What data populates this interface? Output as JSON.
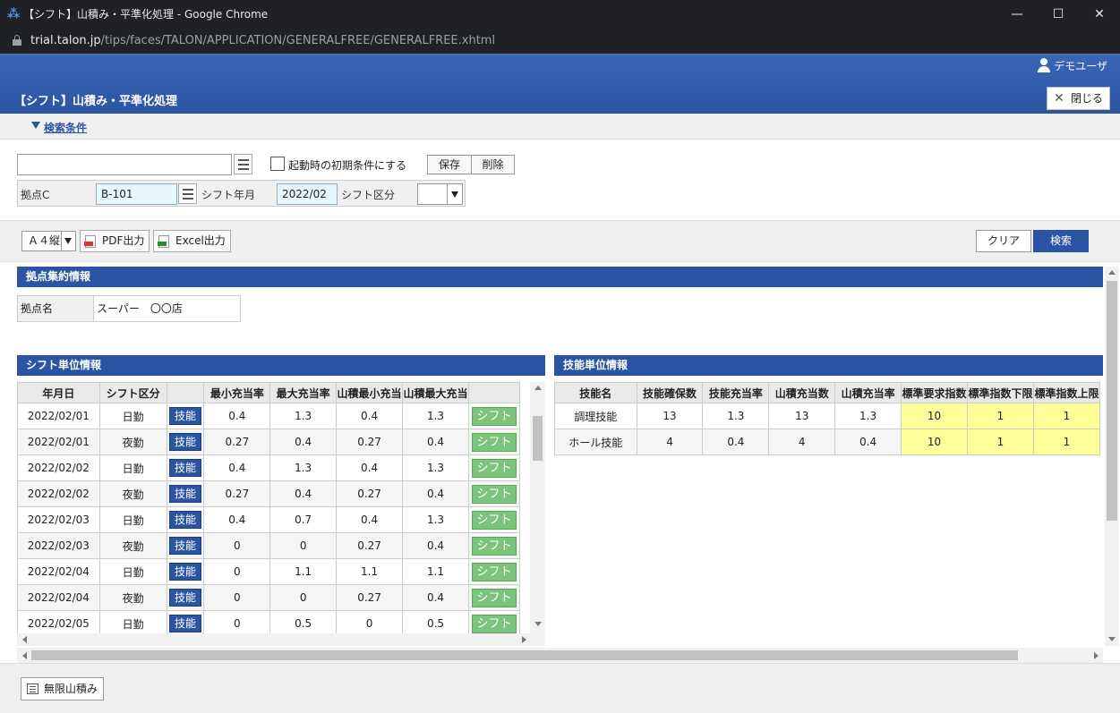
{
  "window": {
    "title": "【シフト】山積み・平準化処理 - Google Chrome",
    "url_host": "trial.talon.jp",
    "url_path": "/tips/faces/TALON/APPLICATION/GENERALFREE/GENERALFREE.xhtml",
    "minimize": "—",
    "maximize": "☐",
    "close": "✕"
  },
  "header": {
    "user": "デモユーザ",
    "title": "【シフト】山積み・平準化処理",
    "close_label": "閉じる"
  },
  "search": {
    "toggle_label": "検索条件",
    "condition_value": "",
    "checkbox_label": "起動時の初期条件にする",
    "save_label": "保存",
    "delete_label": "削除",
    "base_label": "拠点C",
    "base_value": "B-101",
    "month_label": "シフト年月",
    "month_value": "2022/02",
    "shift_type_label": "シフト区分",
    "shift_type_value": ""
  },
  "toolbar": {
    "paper": "Ａ４縦",
    "pdf_label": "PDF出力",
    "excel_label": "Excel出力",
    "clear_label": "クリア",
    "search_label": "検索"
  },
  "base_summary": {
    "title": "拠点集約情報",
    "name_label": "拠点名",
    "name_value": "スーパー　〇〇店"
  },
  "shift_info": {
    "title": "シフト単位情報",
    "headers": [
      "年月日",
      "シフト区分",
      "",
      "最小充当率",
      "最大充当率",
      "山積最小充当",
      "山積最大充当",
      ""
    ],
    "skill_button": "技能",
    "shift_button": "シフト",
    "rows": [
      {
        "date": "2022/02/01",
        "type": "日勤",
        "min": "0.4",
        "max": "1.3",
        "ymin": "0.4",
        "ymax": "1.3"
      },
      {
        "date": "2022/02/01",
        "type": "夜勤",
        "min": "0.27",
        "max": "0.4",
        "ymin": "0.27",
        "ymax": "0.4"
      },
      {
        "date": "2022/02/02",
        "type": "日勤",
        "min": "0.4",
        "max": "1.3",
        "ymin": "0.4",
        "ymax": "1.3"
      },
      {
        "date": "2022/02/02",
        "type": "夜勤",
        "min": "0.27",
        "max": "0.4",
        "ymin": "0.27",
        "ymax": "0.4"
      },
      {
        "date": "2022/02/03",
        "type": "日勤",
        "min": "0.4",
        "max": "0.7",
        "ymin": "0.4",
        "ymax": "1.3"
      },
      {
        "date": "2022/02/03",
        "type": "夜勤",
        "min": "0",
        "max": "0",
        "ymin": "0.27",
        "ymax": "0.4"
      },
      {
        "date": "2022/02/04",
        "type": "日勤",
        "min": "0",
        "max": "1.1",
        "ymin": "1.1",
        "ymax": "1.1"
      },
      {
        "date": "2022/02/04",
        "type": "夜勤",
        "min": "0",
        "max": "0",
        "ymin": "0.27",
        "ymax": "0.4"
      },
      {
        "date": "2022/02/05",
        "type": "日勤",
        "min": "0",
        "max": "0.5",
        "ymin": "0",
        "ymax": "0.5"
      }
    ]
  },
  "skill_info": {
    "title": "技能単位情報",
    "headers": [
      "技能名",
      "技能確保数",
      "技能充当率",
      "山積充当数",
      "山積充当率",
      "標準要求指数",
      "標準指数下限",
      "標準指数上限"
    ],
    "rows": [
      {
        "name": "調理技能",
        "count": "13",
        "rate": "1.3",
        "ycount": "13",
        "yrate": "1.3",
        "std": "10",
        "low": "1",
        "high": "1"
      },
      {
        "name": "ホール技能",
        "count": "4",
        "rate": "0.4",
        "ycount": "4",
        "yrate": "0.4",
        "std": "10",
        "low": "1",
        "high": "1"
      }
    ]
  },
  "footer": {
    "unlimited_label": "無限山積み"
  },
  "colors": {
    "accent": "#2b55a3",
    "shift_button": "#7bc47b",
    "highlight": "#ffff99"
  }
}
